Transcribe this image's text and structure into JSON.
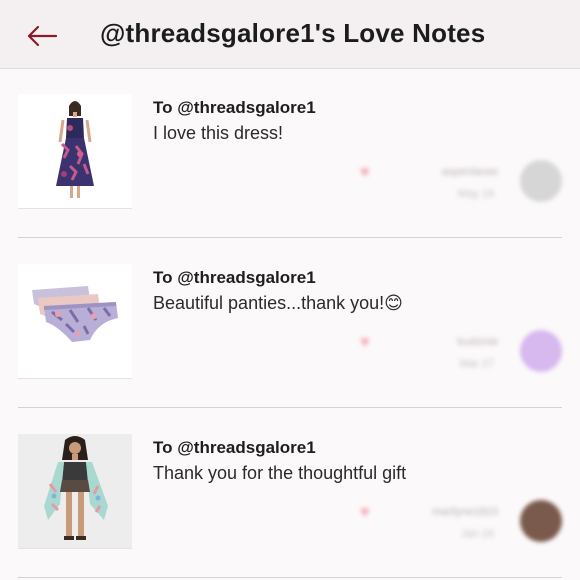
{
  "header": {
    "title": "@threadsgalore1's Love Notes",
    "back_icon": "arrow-left-icon",
    "accent": "#8b1a2b"
  },
  "notes": [
    {
      "recipient": "To @threadsgalore1",
      "message": "I love this dress!",
      "sender": "aspenlacee",
      "date": "May 16",
      "avatar_color": "#d6d6d6",
      "image": "maxi-dress-photo"
    },
    {
      "recipient": "To @threadsgalore1",
      "message": "Beautiful panties...thank you!😊",
      "sender": "kudzinie",
      "date": "Mar 27",
      "avatar_color": "#d7b8ef",
      "image": "panties-photo"
    },
    {
      "recipient": "To @threadsgalore1",
      "message": "Thank you for the thoughtful gift",
      "sender": "marilyne1823",
      "date": "Jan 24",
      "avatar_color": "#7a5a4c",
      "image": "kimono-photo"
    }
  ]
}
